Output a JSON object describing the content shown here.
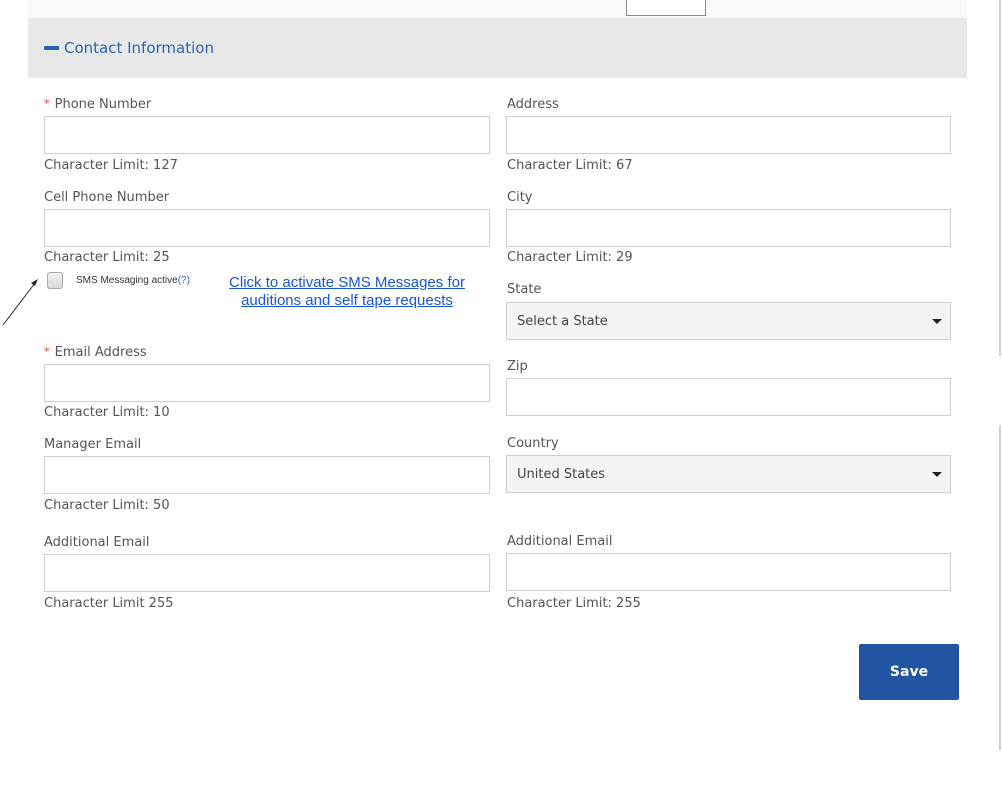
{
  "section": {
    "title": "Contact Information"
  },
  "left_column": {
    "phone": {
      "label": "Phone Number",
      "required_mark": "*",
      "value": "",
      "limit": "Character Limit: 127"
    },
    "cell_phone": {
      "label": "Cell Phone Number",
      "value": "",
      "limit": "Character Limit: 25"
    },
    "sms": {
      "label": "SMS Messaging active",
      "help": "(?)",
      "checked": false,
      "link_line1": "Click to activate SMS Messages for",
      "link_line2": "auditions and self tape requests"
    },
    "email": {
      "label": "Email Address",
      "required_mark": "*",
      "value": "",
      "limit": "Character Limit: 10"
    },
    "manager_email": {
      "label": "Manager Email",
      "value": "",
      "limit": "Character Limit: 50"
    },
    "additional_email": {
      "label": "Additional Email",
      "value": "",
      "limit": "Character Limit 255"
    }
  },
  "right_column": {
    "address": {
      "label": "Address",
      "value": "",
      "limit": "Character Limit: 67"
    },
    "city": {
      "label": "City",
      "value": "",
      "limit": "Character Limit: 29"
    },
    "state": {
      "label": "State",
      "selected": "Select a State"
    },
    "zip": {
      "label": "Zip",
      "value": ""
    },
    "country": {
      "label": "Country",
      "selected": "United States"
    },
    "additional_email": {
      "label": "Additional Email",
      "value": "",
      "limit": "Character Limit: 255"
    }
  },
  "actions": {
    "save_label": "Save"
  },
  "colors": {
    "accent": "#2a63b6",
    "save_bg": "#2155a3",
    "required": "#e0443c",
    "link": "#1a57d6"
  }
}
